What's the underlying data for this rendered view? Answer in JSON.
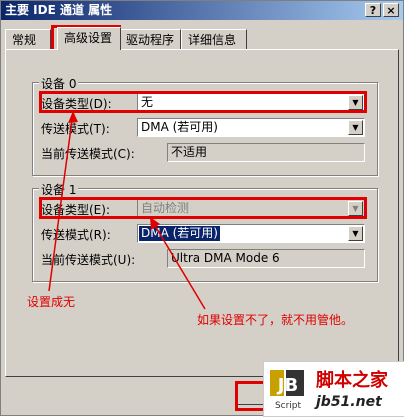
{
  "window": {
    "title": "主要 IDE 通道 属性",
    "help_btn": "?",
    "close_btn": "×"
  },
  "tabs": [
    {
      "label": "常规",
      "active": false
    },
    {
      "label": "高级设置",
      "active": true
    },
    {
      "label": "驱动程序",
      "active": false
    },
    {
      "label": "详细信息",
      "active": false
    }
  ],
  "device0": {
    "group_title": "设备 0",
    "type_label": "设备类型(D):",
    "type_value": "无",
    "mode_label": "传送模式(T):",
    "mode_value": "DMA (若可用)",
    "current_label": "当前传送模式(C):",
    "current_value": "不适用"
  },
  "device1": {
    "group_title": "设备 1",
    "type_label": "设备类型(E):",
    "type_value": "自动检测",
    "mode_label": "传送模式(R):",
    "mode_value": "DMA (若可用)",
    "current_label": "当前传送模式(U):",
    "current_value": "Ultra DMA Mode 6"
  },
  "annotations": {
    "left_note": "设置成无",
    "right_note": "如果设置不了，就不用管他。"
  },
  "watermark": {
    "logo_letters": "JB",
    "logo_sub": "Script",
    "site_name": "脚本之家",
    "site_url": "jb51.net"
  },
  "colors": {
    "annotation_red": "#e00000",
    "titlebar": "#0a246a",
    "face": "#d4d0c8"
  }
}
